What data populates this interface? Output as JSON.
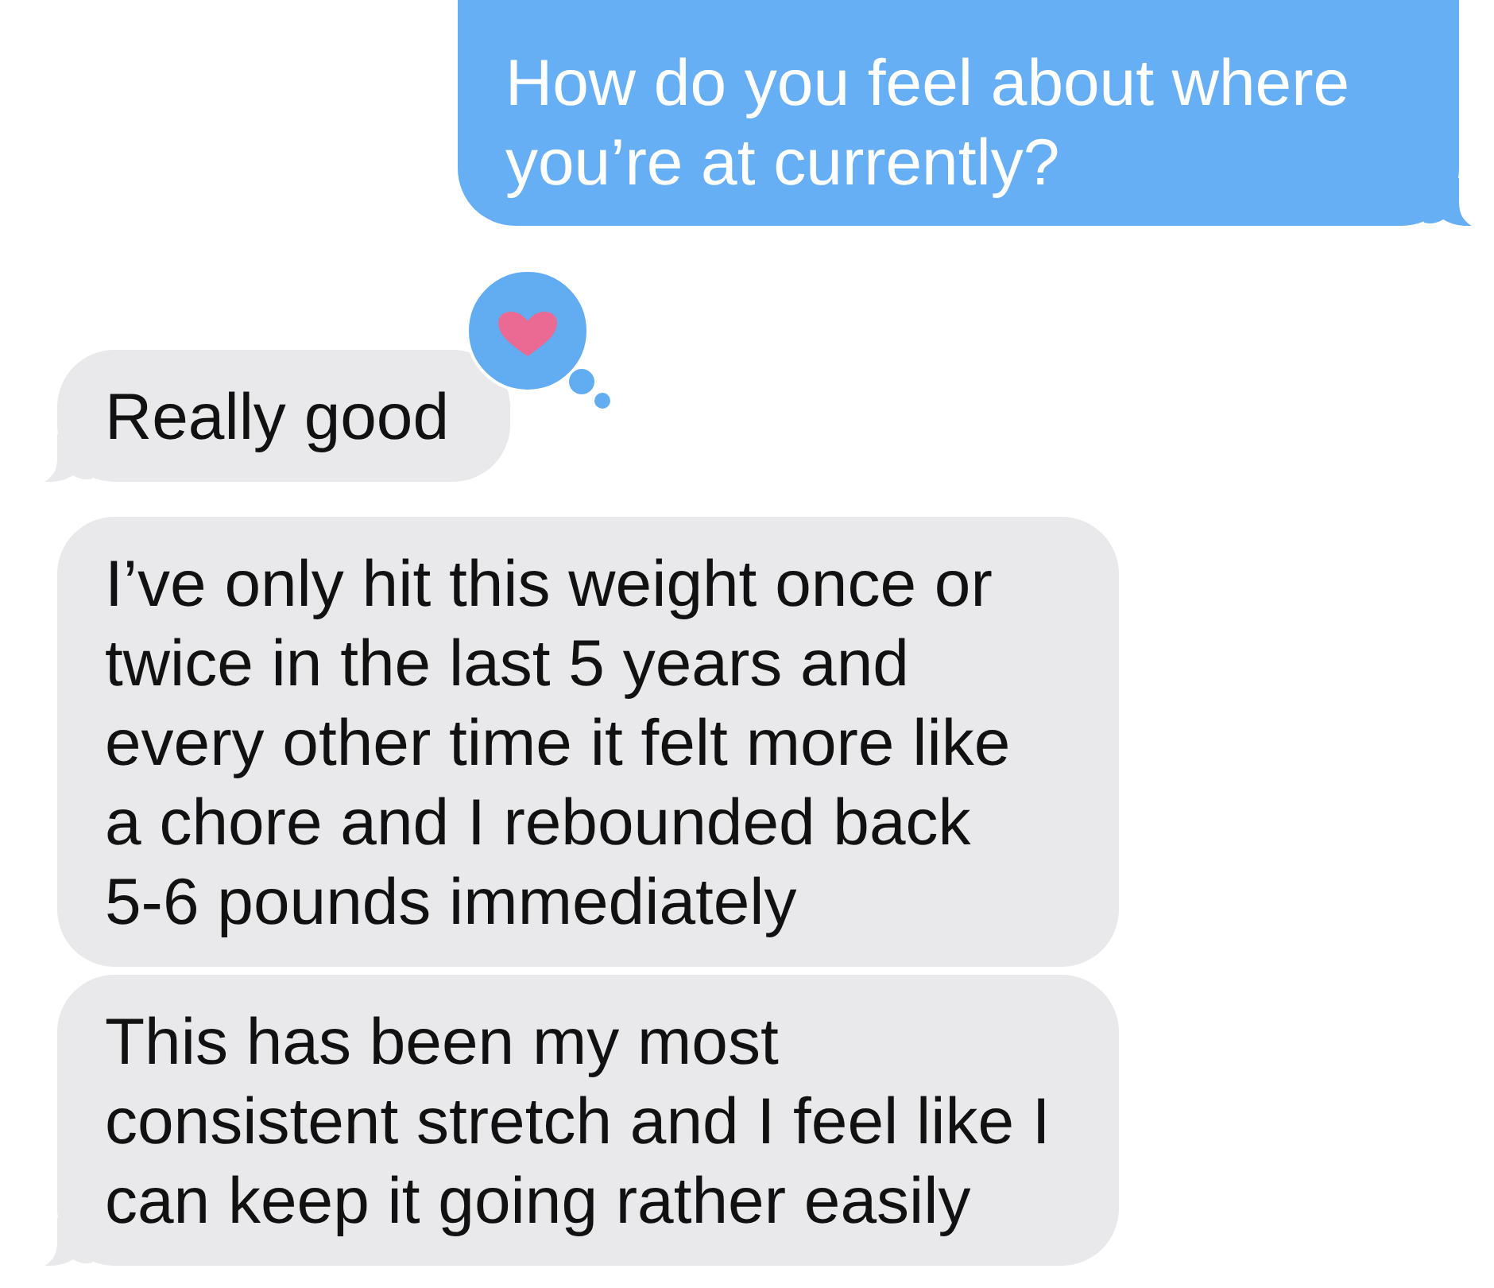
{
  "messages": [
    {
      "kind": "sent",
      "text": "How do you feel about where you’re at currently?",
      "tail": true
    },
    {
      "kind": "received",
      "text": "Really good",
      "tail": true,
      "hearted": true
    },
    {
      "kind": "received",
      "text": "I’ve only hit this weight once or twice in the last 5 years and every other time it felt more like a chore and I rebounded back 5-6 pounds immediately",
      "tail": false
    },
    {
      "kind": "received",
      "text": "This has been my most consistent stretch and I feel like I can keep it going rather easily",
      "tail": true
    }
  ]
}
